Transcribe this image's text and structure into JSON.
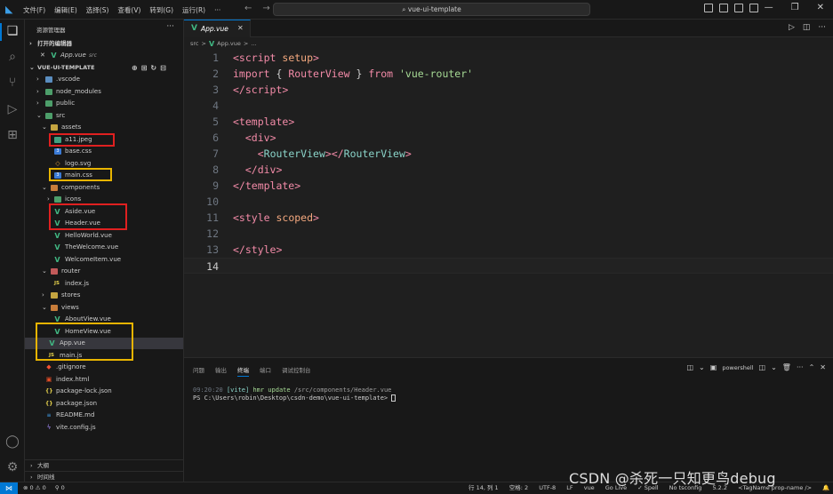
{
  "titlebar": {
    "menu": [
      "文件(F)",
      "编辑(E)",
      "选择(S)",
      "查看(V)",
      "转到(G)",
      "运行(R)",
      "···"
    ],
    "search": "vue-ui-template"
  },
  "sidebar": {
    "title": "资源管理器",
    "more": "···",
    "open_editors_label": "打开的编辑器",
    "open_editor_file": "App.vue",
    "open_editor_dir": "src",
    "project_label": "VUE-UI-TEMPLATE",
    "tree": [
      {
        "label": ".vscode",
        "icon": "folder-icon"
      },
      {
        "label": "node_modules",
        "icon": "folder-icon"
      },
      {
        "label": "public",
        "icon": "folder-icon"
      },
      {
        "label": "src",
        "icon": "folder-icon"
      },
      {
        "label": "assets",
        "icon": "folder-icon"
      },
      {
        "label": "a11.jpeg",
        "icon": "image-icon"
      },
      {
        "label": "base.css",
        "icon": "css-icon"
      },
      {
        "label": "logo.svg",
        "icon": "svg-icon"
      },
      {
        "label": "main.css",
        "icon": "css-icon"
      },
      {
        "label": "components",
        "icon": "folder-icon"
      },
      {
        "label": "icons",
        "icon": "folder-icon"
      },
      {
        "label": "Aside.vue",
        "icon": "vue-icon"
      },
      {
        "label": "Header.vue",
        "icon": "vue-icon"
      },
      {
        "label": "HelloWorld.vue",
        "icon": "vue-icon"
      },
      {
        "label": "TheWelcome.vue",
        "icon": "vue-icon"
      },
      {
        "label": "WelcomeItem.vue",
        "icon": "vue-icon"
      },
      {
        "label": "router",
        "icon": "folder-icon"
      },
      {
        "label": "index.js",
        "icon": "js-icon"
      },
      {
        "label": "stores",
        "icon": "folder-icon"
      },
      {
        "label": "views",
        "icon": "folder-icon"
      },
      {
        "label": "AboutView.vue",
        "icon": "vue-icon"
      },
      {
        "label": "HomeView.vue",
        "icon": "vue-icon"
      },
      {
        "label": "App.vue",
        "icon": "vue-icon"
      },
      {
        "label": "main.js",
        "icon": "js-icon"
      },
      {
        "label": ".gitignore",
        "icon": "git-icon"
      },
      {
        "label": "index.html",
        "icon": "html-icon"
      },
      {
        "label": "package-lock.json",
        "icon": "json-icon"
      },
      {
        "label": "package.json",
        "icon": "json-icon"
      },
      {
        "label": "README.md",
        "icon": "markdown-icon"
      },
      {
        "label": "vite.config.js",
        "icon": "vite-icon"
      }
    ],
    "outline_label": "大纲",
    "timeline_label": "时间线"
  },
  "editor": {
    "tab_label": "App.vue",
    "breadcrumb": [
      "src",
      ">",
      "App.vue",
      ">",
      "..."
    ],
    "line_numbers": [
      "1",
      "2",
      "3",
      "4",
      "5",
      "6",
      "7",
      "8",
      "9",
      "10",
      "11",
      "12",
      "13",
      "14"
    ],
    "lines": {
      "l1a": "<script",
      "l1b": " setup",
      "l1c": ">",
      "l2a": "import",
      "l2b": " { ",
      "l2c": "RouterView",
      "l2d": " } ",
      "l2e": "from",
      "l2f": " 'vue-router'",
      "l3a": "</script",
      "l3b": ">",
      "l5a": "<template",
      "l5b": ">",
      "l6a": "<div",
      "l6b": ">",
      "l7a": "<",
      "l7b": "RouterView",
      "l7c": "></",
      "l7d": "RouterView",
      "l7e": ">",
      "l8a": "</div",
      "l8b": ">",
      "l9a": "</template",
      "l9b": ">",
      "l11a": "<style",
      "l11b": " scoped",
      "l11c": ">",
      "l13a": "</style",
      "l13b": ">"
    }
  },
  "panel": {
    "tabs": [
      "问题",
      "输出",
      "终端",
      "端口",
      "调试控制台"
    ],
    "shell": "powershell",
    "terminal": {
      "time": "09:20:20",
      "vite": "[vite]",
      "hmr": "hmr update",
      "path": "/src/components/Header.vue",
      "prompt": "PS C:\\Users\\robin\\Desktop\\csdn-demo\\vue-ui-template> "
    }
  },
  "statusbar": {
    "errors": "⊗ 0 ⚠ 0",
    "ports": "⚲ 0",
    "right": [
      "行 14, 列 1",
      "空格: 2",
      "UTF-8",
      "LF",
      "vue",
      "Go Live",
      "✓ Spell",
      "No tsconfig",
      "5.2.2",
      "<TagName prop-name />"
    ]
  },
  "watermark": "CSDN @杀死一只知更鸟debug",
  "colors": {
    "accent": "#0078d4",
    "highlight_red": "#e02020",
    "highlight_yellow": "#e8b400"
  }
}
